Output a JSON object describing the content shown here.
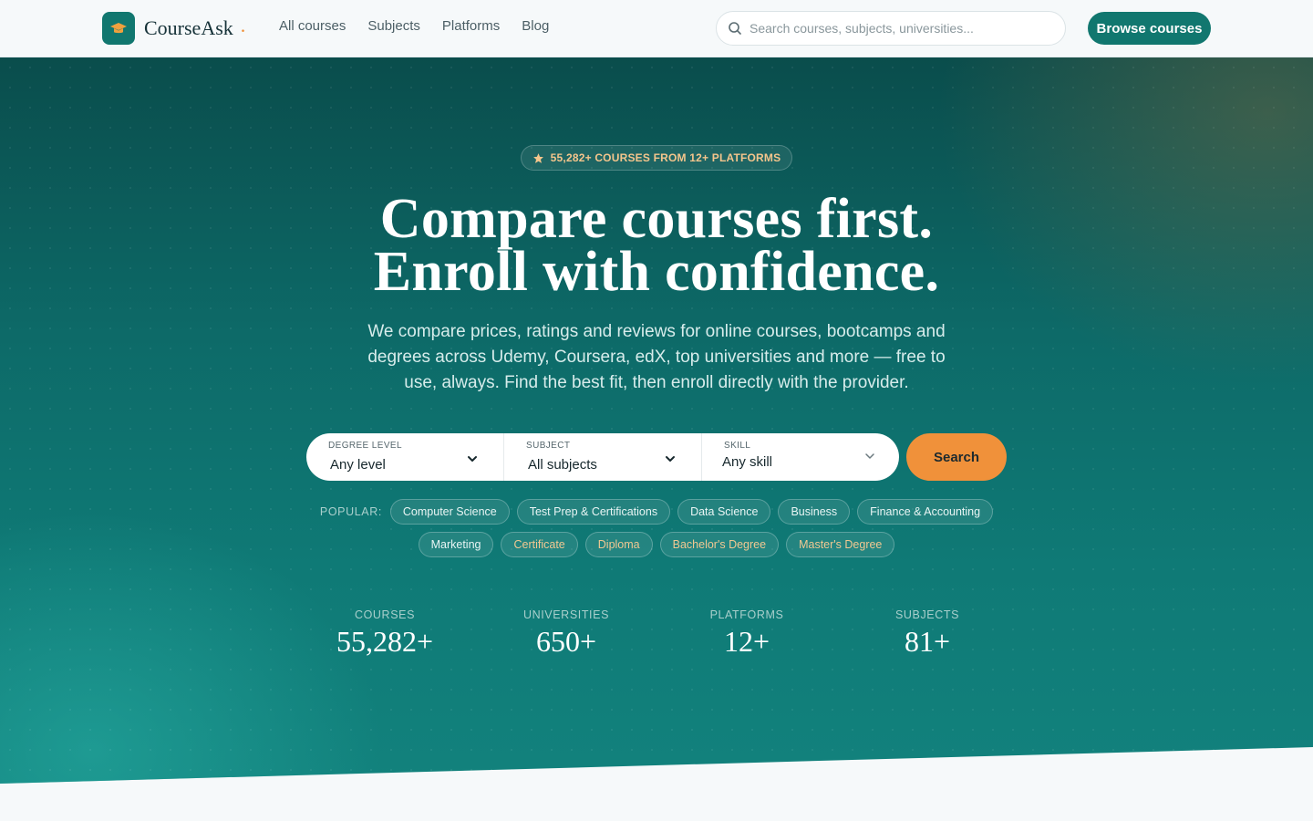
{
  "brand": {
    "name": "CourseAsk",
    "dot": "."
  },
  "nav": {
    "items": [
      "All courses",
      "Subjects",
      "Platforms",
      "Blog"
    ]
  },
  "search": {
    "placeholder": "Search courses, subjects, universities..."
  },
  "header": {
    "cta": "Browse courses"
  },
  "hero": {
    "badge": "55,282+ COURSES FROM 12+ PLATFORMS",
    "headline_line1": "Compare courses first.",
    "headline_line2": "Enroll with confidence.",
    "subcopy": "We compare prices, ratings and reviews for online courses, bootcamps and degrees across Udemy, Coursera, edX, top universities and more — free to use, always. Find the best fit, then enroll directly with the provider."
  },
  "filters": [
    {
      "label": "DEGREE LEVEL",
      "value": "Any level"
    },
    {
      "label": "SUBJECT",
      "value": "All subjects"
    },
    {
      "label": "SKILL",
      "value": "Any skill"
    }
  ],
  "search_button": "Search",
  "popular": {
    "label": "POPULAR:",
    "row1": [
      "Computer Science",
      "Test Prep & Certifications",
      "Data Science",
      "Business",
      "Finance & Accounting"
    ],
    "row2": [
      "Marketing",
      "Certificate",
      "Diploma",
      "Bachelor's Degree",
      "Master's Degree"
    ]
  },
  "stats": [
    {
      "label": "COURSES",
      "value": "55,282+"
    },
    {
      "label": "UNIVERSITIES",
      "value": "650+"
    },
    {
      "label": "PLATFORMS",
      "value": "12+"
    },
    {
      "label": "SUBJECTS",
      "value": "81+"
    }
  ],
  "colors": {
    "brand_teal": "#11776f",
    "accent_orange": "#f0913a",
    "badge_text": "#f4c58c"
  }
}
